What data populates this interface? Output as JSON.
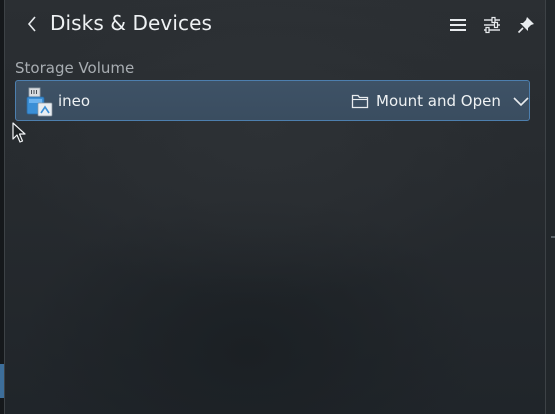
{
  "header": {
    "title": "Disks & Devices",
    "back_icon": "chevron-left-icon",
    "menu_icon": "hamburger-menu-icon",
    "configure_icon": "sliders-icon",
    "pin_icon": "pin-icon"
  },
  "section": {
    "label": "Storage Volume"
  },
  "device": {
    "name": "ineo",
    "icon": "removable-drive-icon",
    "action_label": "Mount and Open",
    "action_icon": "folder-icon",
    "expand_icon": "chevron-down-icon"
  },
  "colors": {
    "accent": "#4d7fae",
    "highlight_bg": "#3e5266",
    "text": "#eef1f3",
    "muted_text": "#a8adb2"
  }
}
